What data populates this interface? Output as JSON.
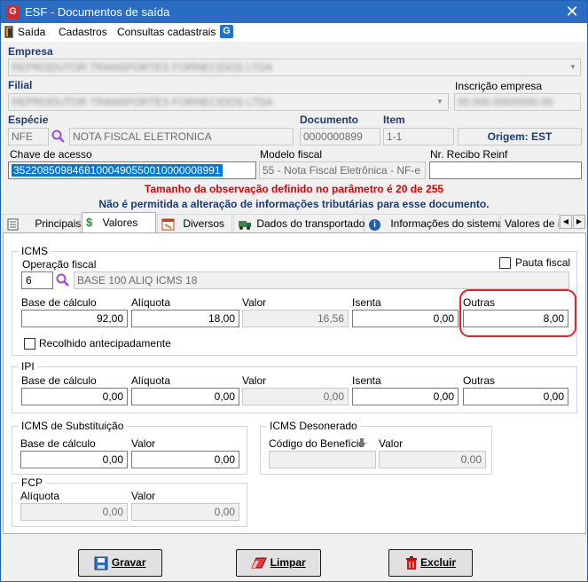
{
  "window": {
    "title": "ESF - Documentos de saída",
    "close": "✕"
  },
  "menu": {
    "items": [
      "Saída",
      "Cadastros",
      "Consultas cadastrais"
    ]
  },
  "empresa": {
    "label": "Empresa",
    "value": "REPRODUTOR TRANSPORTES FORNECIDOS LTDA"
  },
  "filial": {
    "label": "Filial",
    "value": "REPRODUTOR TRANSPORTES FORNECIDOS LTDA"
  },
  "inscricao": {
    "label": "Inscrição empresa",
    "value": "00.000.000/0000-00"
  },
  "especie": {
    "label": "Espécie",
    "code": "NFE",
    "desc": "NOTA FISCAL ELETRONICA"
  },
  "documento": {
    "label": "Documento",
    "value": "0000000899"
  },
  "item": {
    "label": "Item",
    "value": "1-1"
  },
  "origem": "Origem: EST",
  "chave": {
    "label": "Chave de acesso",
    "value": "35220850984681000490550010000008991"
  },
  "modelo": {
    "label": "Modelo fiscal",
    "value": "55 - Nota Fiscal Eletrônica - NF-e"
  },
  "recibo": {
    "label": "Nr. Recibo Reinf",
    "value": ""
  },
  "warnings": {
    "line1": "Tamanho da observação definido no parâmetro é 20 de 255",
    "line2": "Não é permitida a alteração de informações tributárias para esse documento."
  },
  "tabs": [
    "Principais",
    "Valores",
    "Diversos",
    "Dados do transportador",
    "Informações do sistema",
    "Valores de i"
  ],
  "icms": {
    "title": "ICMS",
    "operacao_label": "Operação fiscal",
    "operacao_code": "6",
    "operacao_desc": "BASE 100 ALIQ ICMS 18",
    "pauta_label": "Pauta fiscal",
    "base_label": "Base de cálculo",
    "base": "92,00",
    "aliquota_label": "Alíquota",
    "aliquota": "18,00",
    "valor_label": "Valor",
    "valor": "16,56",
    "isenta_label": "Isenta",
    "isenta": "0,00",
    "outras_label": "Outras",
    "outras": "8,00",
    "recolhido_label": "Recolhido antecipadamente"
  },
  "ipi": {
    "title": "IPI",
    "base_label": "Base de cálculo",
    "base": "0,00",
    "aliquota_label": "Alíquota",
    "aliquota": "0,00",
    "valor_label": "Valor",
    "valor": "0,00",
    "isenta_label": "Isenta",
    "isenta": "0,00",
    "outras_label": "Outras",
    "outras": "0,00"
  },
  "icms_st": {
    "title": "ICMS de Substituição",
    "base_label": "Base de cálculo",
    "base": "0,00",
    "valor_label": "Valor",
    "valor": "0,00"
  },
  "icms_des": {
    "title": "ICMS Desonerado",
    "codigo_label": "Código do Benefício",
    "codigo": "",
    "valor_label": "Valor",
    "valor": "0,00"
  },
  "fcp": {
    "title": "FCP",
    "aliquota_label": "Alíquota",
    "aliquota": "0,00",
    "valor_label": "Valor",
    "valor": "0,00"
  },
  "buttons": {
    "gravar": "Gravar",
    "limpar": "Limpar",
    "excluir": "Excluir"
  },
  "colors": {
    "title_bar": "#2a6cc2",
    "label_blue": "#1e3a6e",
    "warning_red": "#e00000",
    "highlight": "#e8202a"
  }
}
